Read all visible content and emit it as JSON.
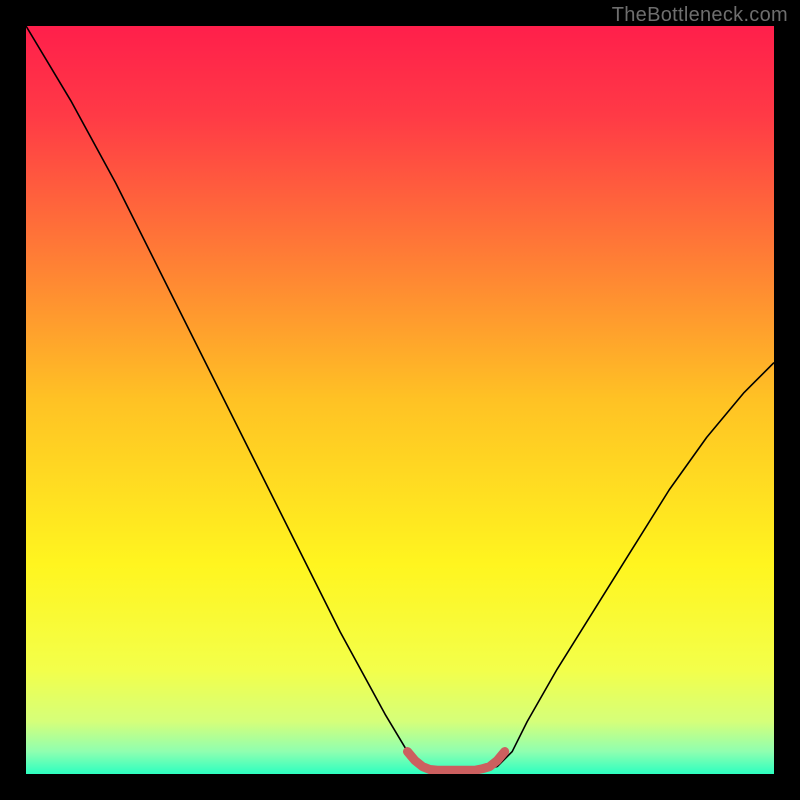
{
  "watermark": "TheBottleneck.com",
  "chart_data": {
    "type": "line",
    "title": "",
    "xlabel": "",
    "ylabel": "",
    "xlim": [
      0,
      100
    ],
    "ylim": [
      0,
      1
    ],
    "grid": false,
    "legend": false,
    "background_gradient": {
      "stops": [
        {
          "offset": 0.0,
          "color": "#ff1f4b"
        },
        {
          "offset": 0.12,
          "color": "#ff3a46"
        },
        {
          "offset": 0.3,
          "color": "#ff7a36"
        },
        {
          "offset": 0.5,
          "color": "#ffc224"
        },
        {
          "offset": 0.72,
          "color": "#fff51f"
        },
        {
          "offset": 0.86,
          "color": "#f3ff4a"
        },
        {
          "offset": 0.93,
          "color": "#d5ff7a"
        },
        {
          "offset": 0.97,
          "color": "#8fffb0"
        },
        {
          "offset": 1.0,
          "color": "#2dffc0"
        }
      ]
    },
    "series": [
      {
        "name": "bottleneck-curve",
        "color": "#000000",
        "width": 1.6,
        "x": [
          0,
          6,
          12,
          18,
          24,
          30,
          36,
          42,
          48,
          51,
          53,
          55,
          57,
          59,
          61,
          63,
          65,
          67,
          71,
          76,
          81,
          86,
          91,
          96,
          100
        ],
        "y": [
          1.0,
          0.9,
          0.79,
          0.67,
          0.55,
          0.43,
          0.31,
          0.19,
          0.08,
          0.03,
          0.01,
          0.005,
          0.005,
          0.005,
          0.005,
          0.01,
          0.03,
          0.07,
          0.14,
          0.22,
          0.3,
          0.38,
          0.45,
          0.51,
          0.55
        ]
      },
      {
        "name": "optimal-range-highlight",
        "color": "#cc5f5f",
        "width": 9,
        "linecap": "round",
        "x": [
          51.0,
          52.0,
          53.0,
          54.0,
          55.0,
          56.0,
          57.0,
          58.0,
          59.0,
          60.0,
          61.0,
          62.0,
          63.0,
          64.0
        ],
        "y": [
          0.03,
          0.018,
          0.01,
          0.006,
          0.005,
          0.005,
          0.005,
          0.005,
          0.005,
          0.005,
          0.007,
          0.01,
          0.018,
          0.03
        ]
      }
    ]
  }
}
